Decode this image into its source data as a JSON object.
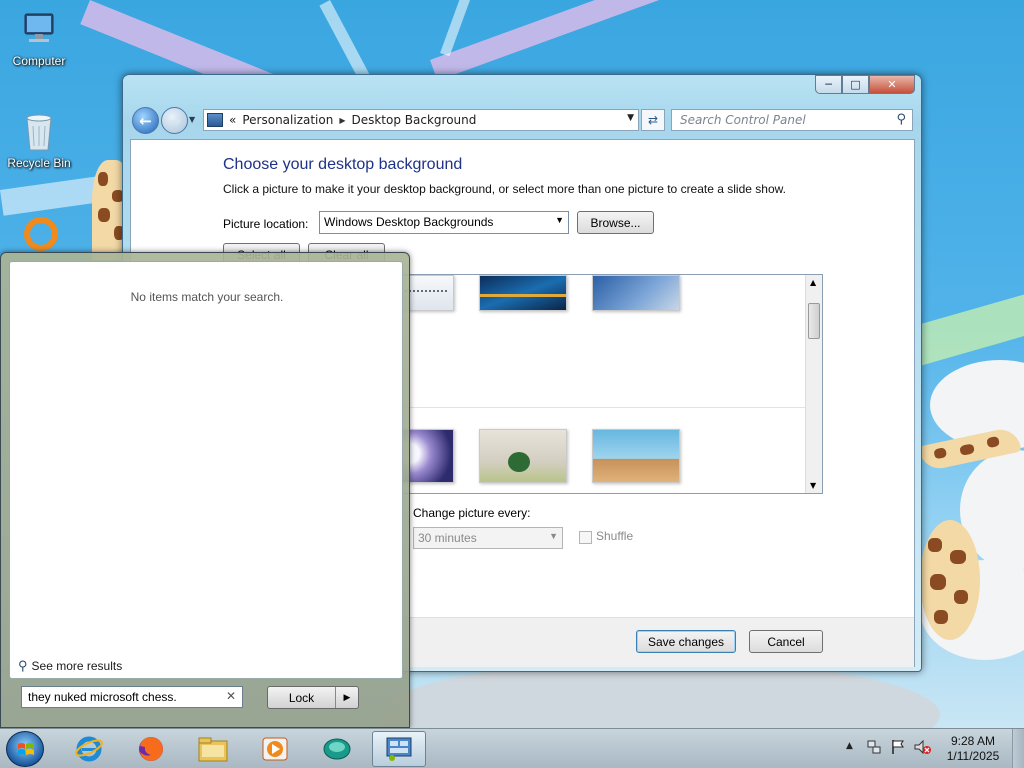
{
  "desktop": {
    "icons": [
      {
        "label": "Computer",
        "icon": "computer-icon"
      },
      {
        "label": "Recycle Bin",
        "icon": "recycle-bin-icon"
      }
    ]
  },
  "control_panel": {
    "breadcrumb": {
      "overflow": "«",
      "items": [
        "Personalization",
        "Desktop Background"
      ]
    },
    "search_placeholder": "Search Control Panel",
    "title": "Choose your desktop background",
    "description": "Click a picture to make it your desktop background, or select more than one picture to create a slide show.",
    "picture_location_label": "Picture location:",
    "picture_location_value": "Windows Desktop Backgrounds",
    "browse_label": "Browse...",
    "select_all_label": "Select all",
    "clear_all_label": "Clear all",
    "change_picture_label": "Change picture every:",
    "interval_value": "30 minutes",
    "shuffle_label": "Shuffle",
    "save_label": "Save changes",
    "cancel_label": "Cancel"
  },
  "start_menu": {
    "no_items_text": "No items match your search.",
    "see_more_results": "See more results",
    "search_value": "they nuked microsoft chess.",
    "lock_label": "Lock"
  },
  "taskbar": {
    "apps": [
      "internet-explorer-icon",
      "firefox-icon",
      "windows-explorer-icon",
      "media-player-icon",
      "chess-app-icon",
      "control-panel-icon"
    ],
    "clock_time": "9:28 AM",
    "clock_date": "1/11/2025"
  }
}
